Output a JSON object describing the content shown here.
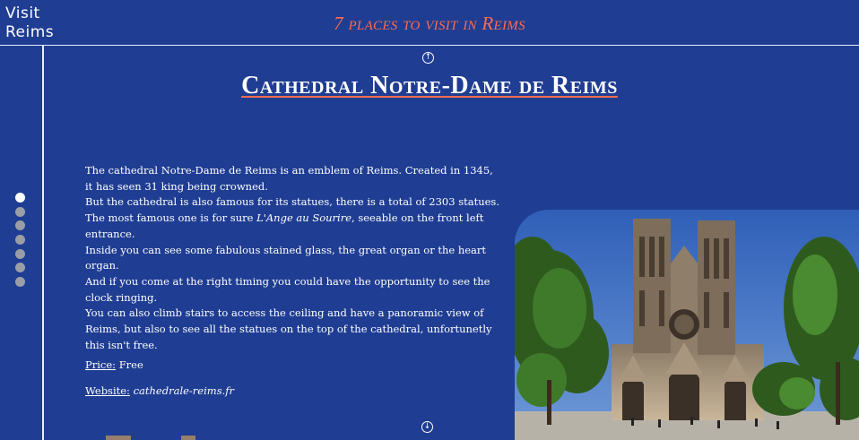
{
  "header": {
    "brand": "Visit Reims",
    "title": "7 places to visit in Reims"
  },
  "navigation": {
    "up_icon": "arrow-up-circle-icon",
    "down_icon": "arrow-down-circle-icon",
    "slides": 7,
    "active_slide": 1
  },
  "place": {
    "title": "Cathedral Notre-Dame de Reims",
    "desc1": "The cathedral Notre-Dame de Reims is an emblem of Reims. Created in 1345, it has seen 31 king being crowned.",
    "desc2_before": "But the cathedral is also famous for its statues, there is a total of 2303 statues. The most famous one is for sure ",
    "desc2_em": "L'Ange au Sourire",
    "desc2_after": ", seeable on the front left entrance.",
    "desc3": "Inside you can see some fabulous stained glass, the great organ or the heart organ.",
    "desc4": "And if you come at the right timing you could have the opportunity to see the clock ringing.",
    "desc5": "You can also climb stairs to access the ceiling and have a panoramic view of Reims, but also to see all the statues on the top of the cathedral, unfortunetly this isn't free.",
    "price_label": "Price:",
    "price_value": "Free",
    "website_label": "Website:",
    "website_value": "cathedrale-reims.fr"
  },
  "colors": {
    "background": "#1f3d92",
    "accent": "#ff6b4e",
    "text": "#ffffff",
    "dot_inactive": "#9a9ea6"
  }
}
